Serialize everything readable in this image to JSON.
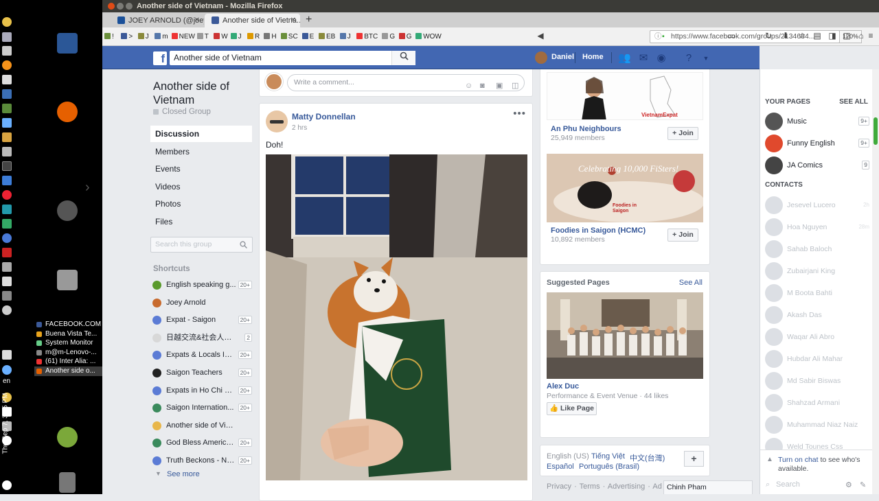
{
  "window": {
    "title": "Another side of Vietnam - Mozilla Firefox"
  },
  "tabs": [
    {
      "label": "JOEY ARNOLD (@joey..."
    },
    {
      "label": "Another side of Vietna..."
    }
  ],
  "bookmarks": [
    "!",
    ">",
    "J",
    "m",
    "NEW",
    "T",
    "W",
    "J",
    "R",
    "H",
    "SC",
    "E",
    "EB",
    "J",
    "BTC",
    "G",
    "G",
    "WOW"
  ],
  "browser": {
    "url": "https://www.facebook.com/groups/2134684...",
    "zoom": "120%"
  },
  "dock": {
    "windows": [
      {
        "label": "FACEBOOK.COM",
        "color": "#3b5998"
      },
      {
        "label": "Buena Vista Te...",
        "color": "#e8a31c"
      },
      {
        "label": "System Monitor",
        "color": "#6c8"
      },
      {
        "label": "m@m-Lenovo-...",
        "color": "#888"
      },
      {
        "label": "(61) Inter Alia: ...",
        "color": "#e33"
      },
      {
        "label": "Another side o...",
        "color": "#e66000"
      }
    ],
    "language": "en",
    "clock": "Thu Sep 7, 3:15 PM"
  },
  "fb": {
    "search_value": "Another side of Vietnam",
    "user_name": "Daniel",
    "home_label": "Home"
  },
  "group": {
    "title": "Another side of Vietnam",
    "type": "Closed Group",
    "nav": [
      "Discussion",
      "Members",
      "Events",
      "Videos",
      "Photos",
      "Files"
    ],
    "search_placeholder": "Search this group",
    "shortcuts_heading": "Shortcuts",
    "shortcuts": [
      {
        "label": "English speaking g...",
        "count": "20+",
        "color": "#5a9a2c"
      },
      {
        "label": "Joey Arnold",
        "count": "",
        "color": "#c86b2e"
      },
      {
        "label": "Expat - Saigon",
        "count": "20+",
        "color": "#5b7bd5"
      },
      {
        "label": "日越交流&社会人ボ...",
        "count": "2",
        "color": "#d8d8d8"
      },
      {
        "label": "Expats & Locals In ...",
        "count": "20+",
        "color": "#5b7bd5"
      },
      {
        "label": "Saigon Teachers",
        "count": "20+",
        "color": "#222222"
      },
      {
        "label": "Expats in Ho Chi Mi...",
        "count": "20+",
        "color": "#5b7bd5"
      },
      {
        "label": "Saigon Internation...",
        "count": "20+",
        "color": "#3a8a5c"
      },
      {
        "label": "Another side of Vietnam",
        "count": "",
        "color": "#e8b64a"
      },
      {
        "label": "God Bless America...",
        "count": "20+",
        "color": "#3a8a5c"
      },
      {
        "label": "Truth Beckons - No...",
        "count": "20+",
        "color": "#5b7bd5"
      }
    ],
    "see_more": "See more"
  },
  "comment": {
    "placeholder": "Write a comment..."
  },
  "post": {
    "author": "Matty Donnellan",
    "time": "2 hrs",
    "text": "Doh!"
  },
  "suggested_groups": [
    {
      "name": "An Phu Neighbours",
      "members": "25,949 members",
      "join": "Join",
      "image_text": "VietnamExpat"
    },
    {
      "name": "Foodies in Saigon (HCMC)",
      "members": "10,892 members",
      "join": "Join",
      "image_text": "Celebrating 10,000 FiSters!",
      "image_text2": "Foodies in Saigon"
    }
  ],
  "suggested_pages": {
    "heading": "Suggested Pages",
    "see_all": "See All",
    "name": "Alex Duc",
    "sub": "Performance & Event Venue · 44 likes",
    "like": "Like Page"
  },
  "languages": {
    "current": "English (US)",
    "options": [
      "Tiếng Việt",
      "中文(台灣)",
      "Español",
      "Português (Brasil)"
    ]
  },
  "footer": [
    "Privacy",
    "Terms",
    "Advertising",
    "Ad Choices"
  ],
  "chat": {
    "your_pages": "YOUR PAGES",
    "see_all": "SEE ALL",
    "pages": [
      {
        "name": "Music",
        "count": "9+",
        "color": "#555555"
      },
      {
        "name": "Funny English",
        "count": "9+",
        "color": "#e0492d"
      },
      {
        "name": "JA Comics",
        "count": "9",
        "color": "#444444"
      }
    ],
    "contacts_heading": "CONTACTS",
    "contacts": [
      {
        "name": "Jesevel Lucero",
        "time": "2h"
      },
      {
        "name": "Hoa Nguyen",
        "time": "28m"
      },
      {
        "name": "Sahab Baloch",
        "time": ""
      },
      {
        "name": "Zubairjani King",
        "time": ""
      },
      {
        "name": "M Boota Bahti",
        "time": ""
      },
      {
        "name": "Akash Das",
        "time": ""
      },
      {
        "name": "Waqar Ali Abro",
        "time": ""
      },
      {
        "name": "Hubdar Ali Mahar",
        "time": ""
      },
      {
        "name": "Md Sabir Biswas",
        "time": ""
      },
      {
        "name": "Shahzad Armani",
        "time": ""
      },
      {
        "name": "Muhammad Niaz Naiz",
        "time": ""
      },
      {
        "name": "Weld Tounes Css",
        "time": ""
      }
    ],
    "turn_on_link": "Turn on chat",
    "turn_on_rest": " to see who's available.",
    "search_placeholder": "Search",
    "open_chat": "Chinh Pham"
  },
  "colors": {
    "fb_blue": "#4267b2",
    "link": "#365899",
    "bg": "#e9ebee"
  }
}
